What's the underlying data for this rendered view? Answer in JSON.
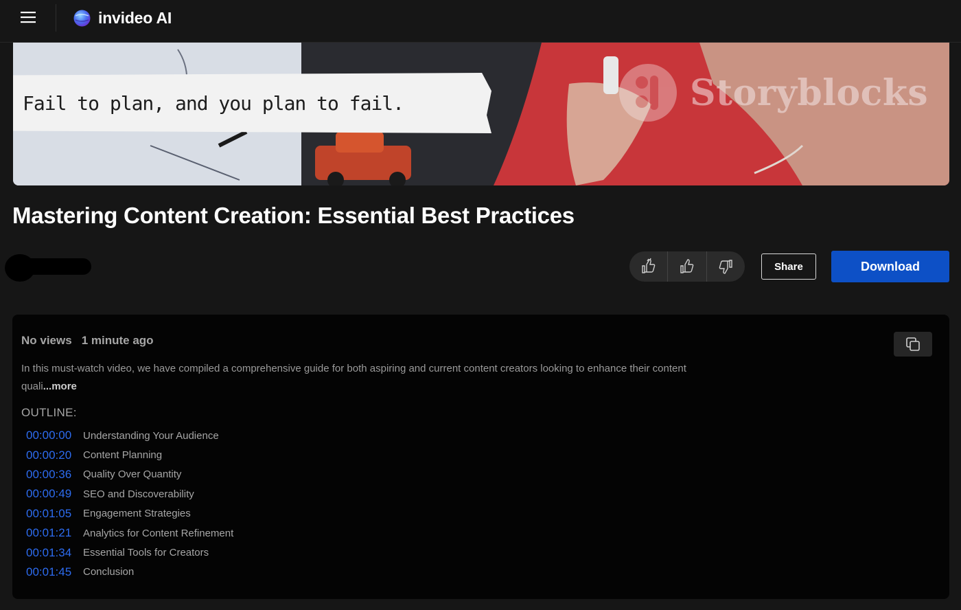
{
  "header": {
    "menu_icon": "hamburger-menu-icon",
    "logo_icon": "invideo-globe-icon",
    "logo_text": "invideo AI"
  },
  "video": {
    "caption": "Fail to plan, and you plan to fail.",
    "watermark_text": "Storyblocks",
    "watermark_icon": "storyblocks-logo-icon"
  },
  "title": "Mastering Content Creation: Essential Best Practices",
  "author": {
    "avatar": "redacted"
  },
  "actions": {
    "reactions": [
      {
        "name": "love-it",
        "icon": "double-thumbs-up-icon"
      },
      {
        "name": "like",
        "icon": "thumbs-up-icon"
      },
      {
        "name": "dislike",
        "icon": "thumbs-down-icon"
      }
    ],
    "share_label": "Share",
    "download_label": "Download"
  },
  "description": {
    "views": "No views",
    "time_ago": "1 minute ago",
    "text": "In this must-watch video, we have compiled a comprehensive guide for both aspiring and current content creators looking to enhance their content quali",
    "more_label": "...more",
    "copy_icon": "copy-icon",
    "outline_label": "OUTLINE:",
    "chapters": [
      {
        "time": "00:00:00",
        "title": "Understanding Your Audience"
      },
      {
        "time": "00:00:20",
        "title": "Content Planning"
      },
      {
        "time": "00:00:36",
        "title": "Quality Over Quantity"
      },
      {
        "time": "00:00:49",
        "title": "SEO and Discoverability"
      },
      {
        "time": "00:01:05",
        "title": "Engagement Strategies"
      },
      {
        "time": "00:01:21",
        "title": "Analytics for Content Refinement"
      },
      {
        "time": "00:01:34",
        "title": "Essential Tools for Creators"
      },
      {
        "time": "00:01:45",
        "title": "Conclusion"
      }
    ]
  },
  "colors": {
    "background": "#161616",
    "panel": "#040404",
    "accent_blue": "#0d50c6",
    "timestamp_blue": "#2d6cf0",
    "muted_text": "#a6a6a6"
  }
}
